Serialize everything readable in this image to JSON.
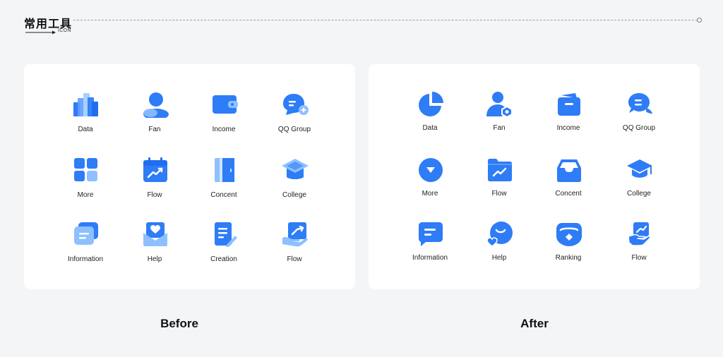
{
  "header": {
    "title": "常用工具",
    "subtitle": "ICON"
  },
  "before": {
    "caption": "Before",
    "items": [
      {
        "label": "Data",
        "icon": "bar-chart-icon"
      },
      {
        "label": "Fan",
        "icon": "person-icon"
      },
      {
        "label": "Income",
        "icon": "wallet-icon"
      },
      {
        "label": "QQ Group",
        "icon": "chat-add-icon"
      },
      {
        "label": "More",
        "icon": "grid-icon"
      },
      {
        "label": "Flow",
        "icon": "calendar-trend-icon"
      },
      {
        "label": "Concent",
        "icon": "door-icon"
      },
      {
        "label": "College",
        "icon": "graduation-cap-icon"
      },
      {
        "label": "Information",
        "icon": "message-icon"
      },
      {
        "label": "Help",
        "icon": "heart-envelope-icon"
      },
      {
        "label": "Creation",
        "icon": "document-pen-icon"
      },
      {
        "label": "Flow",
        "icon": "hand-trend-icon"
      }
    ]
  },
  "after": {
    "caption": "After",
    "items": [
      {
        "label": "Data",
        "icon": "pie-chart-icon"
      },
      {
        "label": "Fan",
        "icon": "person-badge-icon"
      },
      {
        "label": "Income",
        "icon": "wallet-icon"
      },
      {
        "label": "QQ Group",
        "icon": "chat-bubble-icon"
      },
      {
        "label": "More",
        "icon": "dropdown-circle-icon"
      },
      {
        "label": "Flow",
        "icon": "folder-trend-icon"
      },
      {
        "label": "Concent",
        "icon": "inbox-icon"
      },
      {
        "label": "College",
        "icon": "graduation-cap-icon"
      },
      {
        "label": "Information",
        "icon": "message-icon"
      },
      {
        "label": "Help",
        "icon": "smile-heart-icon"
      },
      {
        "label": "Ranking",
        "icon": "badge-icon"
      },
      {
        "label": "Flow",
        "icon": "hand-trend-icon"
      }
    ]
  },
  "colors": {
    "primary": "#2e7cf6",
    "light": "#8ec0ff",
    "pale": "#cfe4ff",
    "background": "#f4f5f7",
    "panel": "#ffffff"
  }
}
